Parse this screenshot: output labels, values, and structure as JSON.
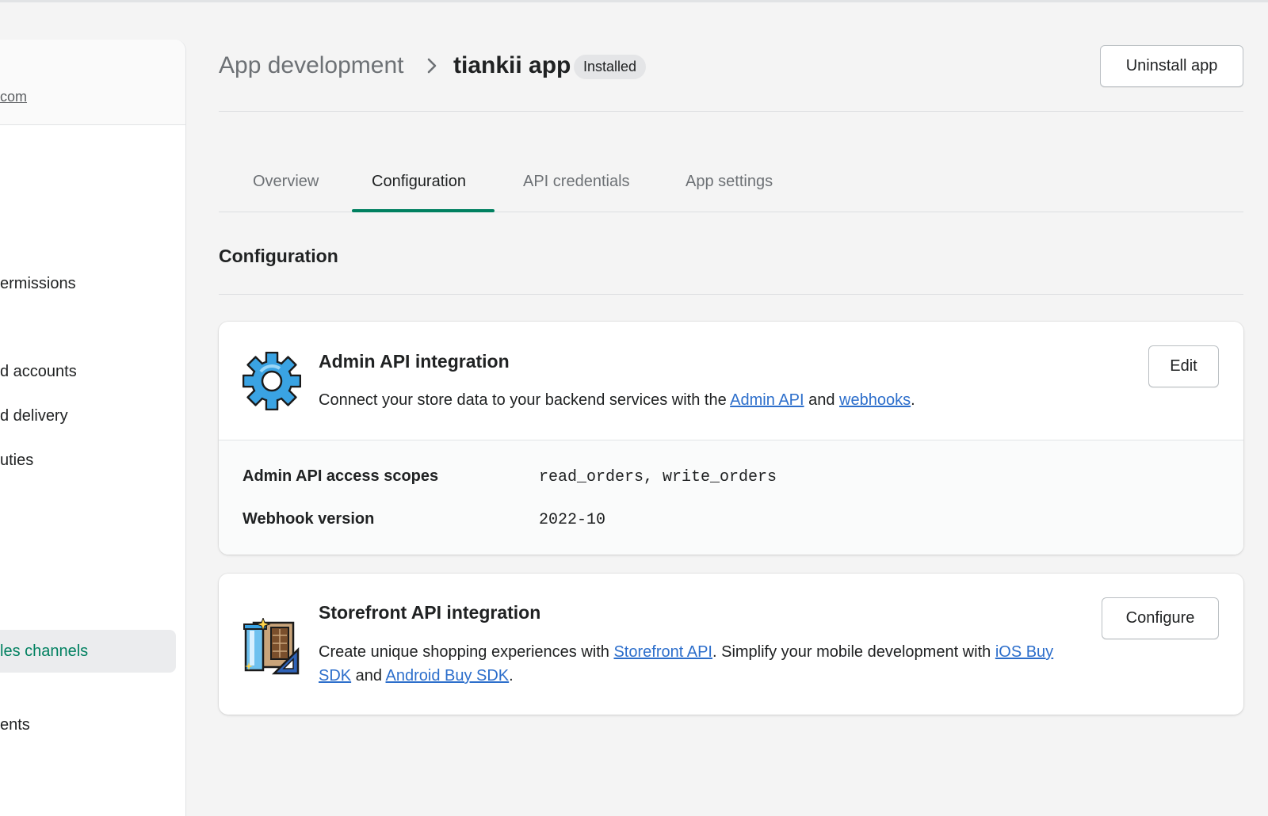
{
  "sidebar": {
    "store_link": "com",
    "items": [
      {
        "label": "ermissions"
      },
      {
        "label": "d accounts"
      },
      {
        "label": "d delivery"
      },
      {
        "label": "uties"
      },
      {
        "label": "les channels",
        "active": true
      },
      {
        "label": "ents"
      }
    ]
  },
  "header": {
    "breadcrumb_parent": "App development",
    "app_title": "tiankii app",
    "status_badge": "Installed",
    "uninstall_label": "Uninstall app"
  },
  "tabs": [
    {
      "label": "Overview"
    },
    {
      "label": "Configuration",
      "active": true
    },
    {
      "label": "API credentials"
    },
    {
      "label": "App settings"
    }
  ],
  "section_title": "Configuration",
  "admin_card": {
    "icon": "gear-icon",
    "title": "Admin API integration",
    "desc_prefix": "Connect your store data to your backend services with the ",
    "link_admin_api": "Admin API",
    "desc_and": " and ",
    "link_webhooks": "webhooks",
    "desc_suffix": ".",
    "edit_label": "Edit",
    "fields": [
      {
        "label": "Admin API access scopes",
        "value": "read_orders, write_orders"
      },
      {
        "label": "Webhook version",
        "value": "2022-10"
      }
    ]
  },
  "storefront_card": {
    "icon": "storefront-icon",
    "title": "Storefront API integration",
    "desc_prefix": "Create unique shopping experiences with ",
    "link_storefront_api": "Storefront API",
    "desc_mid": ". Simplify your mobile development with ",
    "link_ios_sdk": "iOS Buy SDK",
    "desc_and": " and ",
    "link_android_sdk": "Android Buy SDK",
    "desc_suffix": ".",
    "configure_label": "Configure"
  },
  "colors": {
    "accent": "#008060",
    "link": "#2c6ecb",
    "gear": "#3aa3e3"
  }
}
